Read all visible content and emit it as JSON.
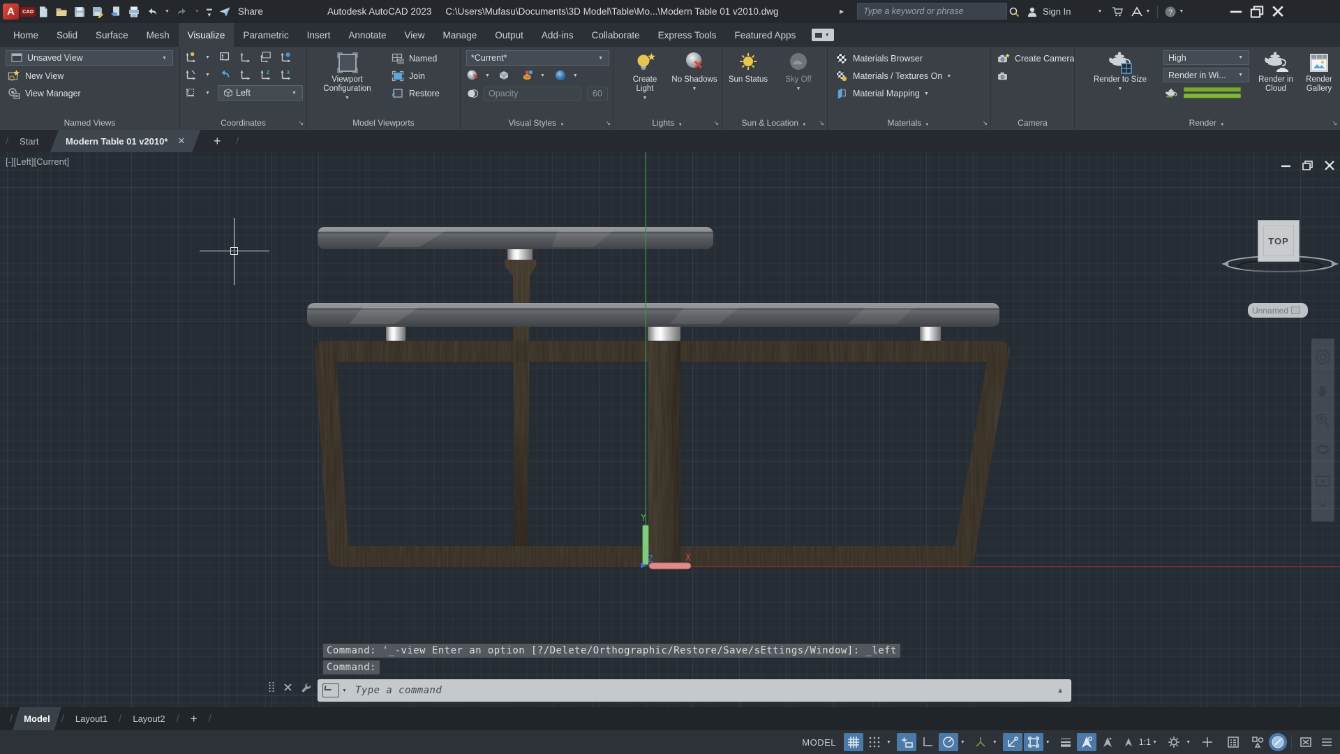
{
  "colors": {
    "canvas_bg": "#262c34",
    "ribbon_bg": "#3a4046",
    "titlebar_bg": "#24282d",
    "status_active_blue": "#4b79a8",
    "logo_red": "#c63b30",
    "ucs_green": "#7ec97e",
    "ucs_red": "#df8d8d",
    "ucs_blue": "#3d6ce0",
    "wood": "#4a4136",
    "slab_gray": "#55585c",
    "metal": "#e8e8e8",
    "render_progress_green": "#7fb335"
  },
  "icons": {
    "help": "?"
  },
  "titlebar": {
    "app_title": "Autodesk AutoCAD 2023",
    "doc_path": "C:\\Users\\Mufasu\\Documents\\3D Model\\Table\\Mo...\\Modern Table 01 v2010.dwg",
    "share_label": "Share",
    "search_placeholder": "Type a keyword or phrase",
    "sign_in_label": "Sign In"
  },
  "ribbon_tabs": [
    {
      "label": "Home"
    },
    {
      "label": "Solid"
    },
    {
      "label": "Surface"
    },
    {
      "label": "Mesh"
    },
    {
      "label": "Visualize"
    },
    {
      "label": "Parametric"
    },
    {
      "label": "Insert"
    },
    {
      "label": "Annotate"
    },
    {
      "label": "View"
    },
    {
      "label": "Manage"
    },
    {
      "label": "Output"
    },
    {
      "label": "Add-ins"
    },
    {
      "label": "Collaborate"
    },
    {
      "label": "Express Tools"
    },
    {
      "label": "Featured Apps"
    }
  ],
  "panels": {
    "named_views": {
      "title": "Named Views",
      "current_view": "Unsaved View",
      "new_view": "New View",
      "view_manager": "View Manager"
    },
    "coordinates": {
      "title": "Coordinates",
      "view_select": "Left"
    },
    "model_viewports": {
      "title": "Model Viewports",
      "viewport_config": "Viewport Configuration",
      "named": "Named",
      "join": "Join",
      "restore": "Restore"
    },
    "visual_styles": {
      "title": "Visual Styles",
      "current": "*Current*",
      "opacity_placeholder": "Opacity",
      "opacity_value": "60"
    },
    "lights": {
      "title": "Lights",
      "create_light": "Create Light",
      "no_shadows": "No Shadows"
    },
    "sun_location": {
      "title": "Sun & Location",
      "sun_status": "Sun Status",
      "sky_off": "Sky Off"
    },
    "materials": {
      "title": "Materials",
      "browser": "Materials Browser",
      "textures_on": "Materials / Textures On",
      "mapping": "Material Mapping"
    },
    "camera": {
      "title": "Camera",
      "create_camera": "Create Camera"
    },
    "render": {
      "title": "Render",
      "render_to_size": "Render to Size",
      "quality": "High",
      "preset": "Render in Wi...",
      "render_in_cloud_1": "Render in",
      "render_in_cloud_2": "Cloud",
      "render_gallery_1": "Render",
      "render_gallery_2": "Gallery"
    }
  },
  "file_tabs": {
    "start": "Start",
    "doc": "Modern Table 01 v2010*"
  },
  "viewport": {
    "label": "[-][Left][Current]",
    "viewcube_face": "TOP",
    "saved_view": "Unnamed",
    "axis_x": "X",
    "axis_y": "Y",
    "axis_z": "Z"
  },
  "command": {
    "history1": "Command: '_-view Enter an option [?/Delete/Orthographic/Restore/Save/sEttings/Window]: _left",
    "history2": "Command:",
    "placeholder": "Type a command"
  },
  "layout_tabs": {
    "model": "Model",
    "layout1": "Layout1",
    "layout2": "Layout2"
  },
  "statusbar": {
    "space": "MODEL",
    "annotation_scale": "1:1"
  }
}
